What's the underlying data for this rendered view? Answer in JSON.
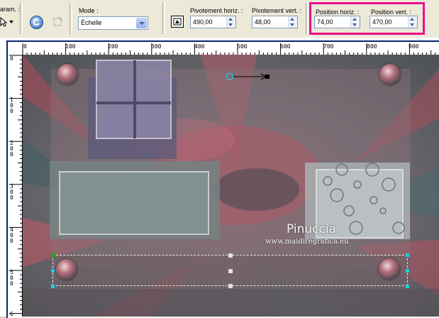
{
  "toolbar": {
    "param_label": "aram. :",
    "mode_label": "Mode :",
    "mode_value": "Échelle",
    "rot_h_label": "Pivotement horiz. :",
    "rot_h_value": "490,00",
    "rot_v_label": "Pivotement vert. :",
    "rot_v_value": "48,00",
    "pos_h_label": "Position horiz. :",
    "pos_h_value": "74,00",
    "pos_v_label": "Position vert. :",
    "pos_v_value": "470,00",
    "highlight_color": "#e8108c"
  },
  "ruler": {
    "h_labels": [
      "0",
      "100",
      "200",
      "300",
      "400",
      "500",
      "600",
      "700",
      "800",
      "900"
    ],
    "v_labels": [
      "0",
      "1 0 0",
      "2 0 0",
      "3 0 0",
      "4 0 0",
      "5 0 0",
      "6"
    ]
  },
  "watermark": {
    "name": "Pinuccia",
    "url": "www.maidiregrafica.eu"
  }
}
